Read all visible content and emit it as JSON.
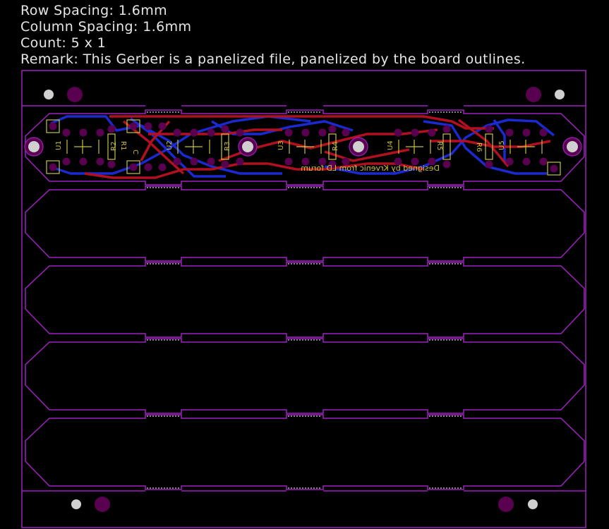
{
  "info": {
    "row_spacing": "Row Spacing: 1.6mm",
    "column_spacing": "Column Spacing: 1.6mm",
    "count": "Count: 5 x 1",
    "remark": "Remark: This Gerber is a panelized file, panelized by the board outlines."
  },
  "board": {
    "credit_text": "Designed by Krvenic    from LD forum",
    "components": {
      "u1": "U1",
      "u2": "U2",
      "u3": "U3",
      "u4": "U4",
      "u5": "U5",
      "r1": "R1",
      "r2": "R2",
      "r3": "R3",
      "r4": "R4",
      "r5": "R5",
      "r6": "R6",
      "c": "C"
    }
  },
  "colors": {
    "outline": "#a020c0",
    "top_copper": "#b01020",
    "bottom_copper": "#1a2ad0",
    "silkscreen": "#c8c040",
    "pad": "#5a0050",
    "hole": "#d0d0d0"
  }
}
